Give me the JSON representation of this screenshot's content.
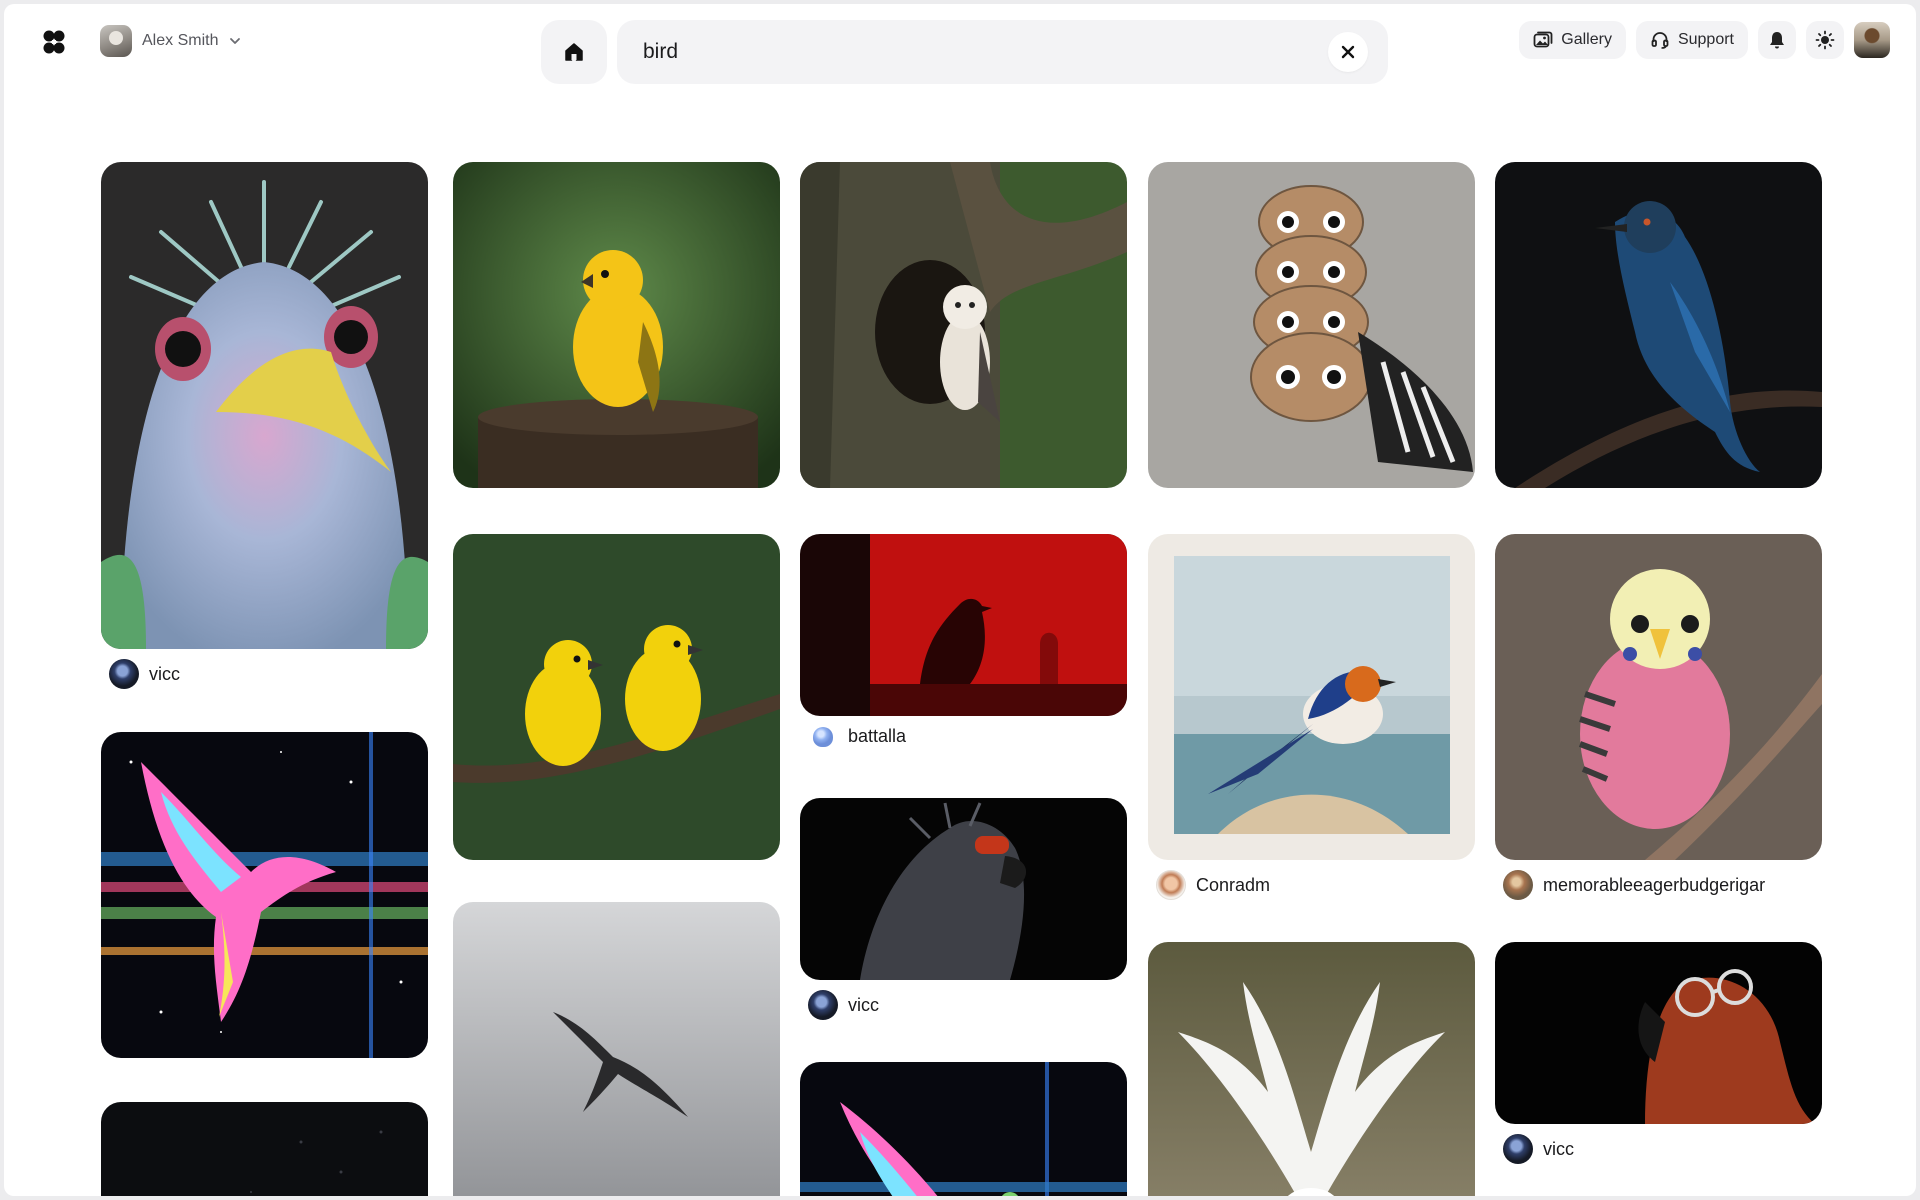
{
  "header": {
    "user_name": "Alex Smith",
    "search_value": "bird",
    "gallery_label": "Gallery",
    "support_label": "Support"
  },
  "grid": {
    "cards": [
      {
        "author": "vicc",
        "subject": "spiky pastel bird"
      },
      {
        "author": "",
        "subject": "rainbow glitch bird"
      },
      {
        "author": "",
        "subject": "dark image"
      },
      {
        "author": "",
        "subject": "yellow bird on stump"
      },
      {
        "author": "",
        "subject": "two yellow birds"
      },
      {
        "author": "",
        "subject": "bird in cloudy sky"
      },
      {
        "author": "",
        "subject": "owl in tree hollow"
      },
      {
        "author": "battalla",
        "subject": "bird silhouette red"
      },
      {
        "author": "vicc",
        "subject": "grey bird sunglasses"
      },
      {
        "author": "",
        "subject": "rainbow bird"
      },
      {
        "author": "",
        "subject": "stacked owl faces"
      },
      {
        "author": "Conradm",
        "subject": "swallow on canvas"
      },
      {
        "author": "",
        "subject": "white dove"
      },
      {
        "author": "",
        "subject": "blue bird on branch"
      },
      {
        "author": "memorableeagerbudgerigar",
        "subject": "pink budgie"
      },
      {
        "author": "vicc",
        "subject": "parrot with glasses"
      }
    ]
  },
  "colors": {
    "accent": "#1b1b1d",
    "surface": "#f3f3f5",
    "muted_text": "#55565c"
  }
}
